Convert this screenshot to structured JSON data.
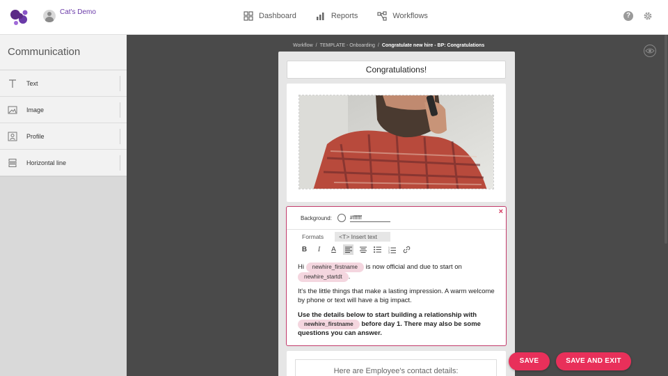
{
  "header": {
    "user_name": "Cat's Demo",
    "nav": [
      {
        "label": "Dashboard",
        "icon": "dashboard-icon"
      },
      {
        "label": "Reports",
        "icon": "reports-icon"
      },
      {
        "label": "Workflows",
        "icon": "workflows-icon"
      }
    ]
  },
  "sidebar": {
    "title": "Communication",
    "items": [
      {
        "label": "Text",
        "icon": "text-icon"
      },
      {
        "label": "Image",
        "icon": "image-icon"
      },
      {
        "label": "Profile",
        "icon": "profile-icon"
      },
      {
        "label": "Horizontal line",
        "icon": "horizontal-line-icon"
      }
    ]
  },
  "breadcrumb": {
    "items": [
      "Workflow",
      "TEMPLATE - Onboarding"
    ],
    "current": "Congratulate new hire - BP: Congratulations"
  },
  "editor": {
    "title": "Congratulations!",
    "text_block": {
      "background_label": "Background:",
      "background_value": "#ffffff",
      "tabs": [
        "Formats",
        "<T> Insert text"
      ],
      "paragraph1_start": "Hi",
      "chip_firstname": "newhire_firstname",
      "paragraph1_mid": "is now official and due to start on",
      "chip_startdt": "newhire_startdt",
      "paragraph1_end": ".",
      "paragraph2": "It's the little things that make a lasting impression. A warm welcome by phone or text will have a big impact.",
      "paragraph3_start": "Use the details below to start building a relationship with",
      "paragraph3_end": "before day 1. There may also be some questions you can answer."
    },
    "contact_heading": "Here are Employee's contact details:"
  },
  "actions": {
    "save": "SAVE",
    "save_exit": "SAVE AND EXIT"
  },
  "colors": {
    "accent": "#e8305a",
    "brand": "#6a3aa8"
  }
}
